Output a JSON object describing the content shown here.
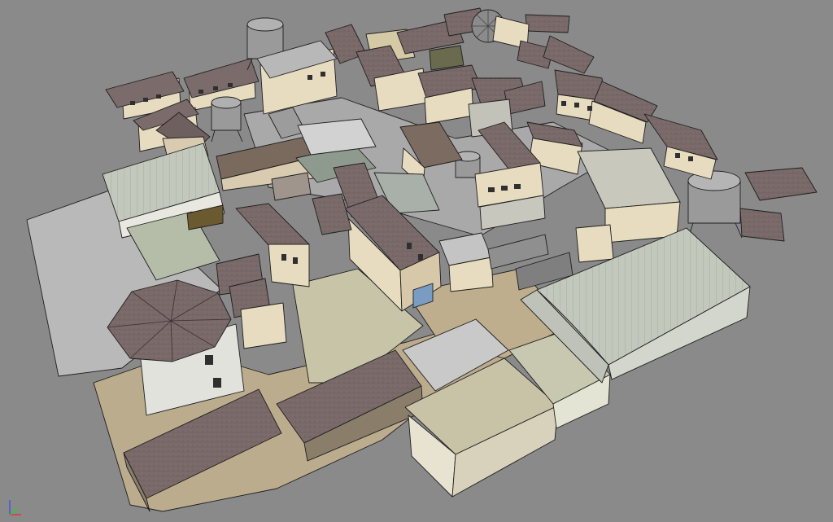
{
  "viewport": {
    "view": "Perspective",
    "background": "#8a8a8a"
  },
  "scene": {
    "kind": "3d-city-block-model",
    "palette": {
      "roof": "#7b6b6b",
      "roof_dark": "#5e5050",
      "wall": "#e8dcc0",
      "wall_shade": "#c9b893",
      "ground": "#b7a88a",
      "plaza": "#bfbfa8",
      "metal_roof": "#c3c8bd",
      "slab": "#b8b8b8",
      "tank": "#9a9a9a",
      "outline": "#1e1e1e"
    }
  },
  "axis_gizmo": {
    "x_color": "#d23c3c",
    "y_color": "#3cc23c",
    "z_color": "#3c5cd8"
  }
}
